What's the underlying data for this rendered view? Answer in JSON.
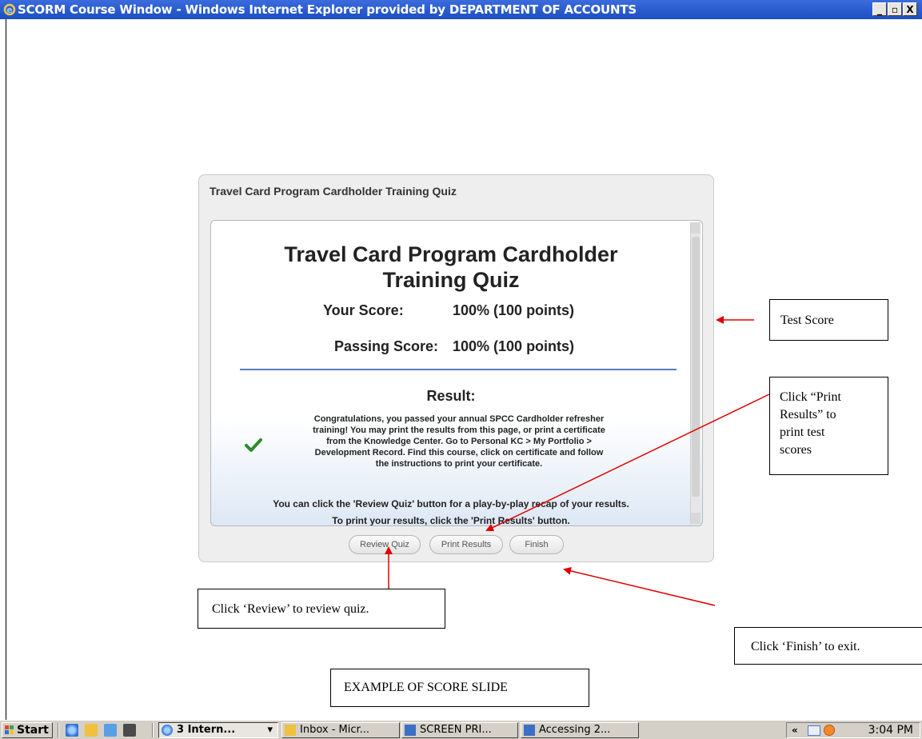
{
  "window": {
    "title": "SCORM Course Window - Windows Internet Explorer provided by DEPARTMENT OF ACCOUNTS",
    "minimize": "_",
    "maximize": "▫",
    "close": "X"
  },
  "course": {
    "panel_title": "Travel Card Program Cardholder Training Quiz",
    "quiz_title_line1": "Travel Card Program Cardholder",
    "quiz_title_line2": "Training Quiz",
    "your_score_label": "Your Score:",
    "your_score_value": "100% (100 points)",
    "passing_score_label": "Passing Score:",
    "passing_score_value": "100% (100 points)",
    "result_label": "Result:",
    "result_lines": [
      "Congratulations, you passed your annual SPCC Cardholder refresher",
      "training!  You may print the results from this page, or print a certificate",
      "from the Knowledge Center.  Go to Personal KC > My Portfolio >",
      "Development Record.  Find this course, click on certificate and follow",
      "the instructions to print your certificate."
    ],
    "review_text": "You can click the 'Review Quiz' button for a play-by-play recap of your results.",
    "print_text": "To print your results, click the 'Print Results' button.",
    "buttons": {
      "review": "Review Quiz",
      "print": "Print Results",
      "finish": "Finish"
    }
  },
  "annotations": {
    "test_score": "Test Score",
    "print_results": [
      "Click “Print",
      "Results” to",
      "print test",
      "scores"
    ],
    "review": "Click ‘Review’ to review quiz.",
    "finish": "Click ‘Finish’ to exit.",
    "example": "EXAMPLE OF SCORE SLIDE"
  },
  "taskbar": {
    "start": "Start",
    "tasks": [
      "3 Intern...",
      "Inbox - Micr...",
      "SCREEN PRI...",
      "Accessing 2..."
    ],
    "clock": "3:04 PM",
    "tray_chevron": "«"
  },
  "colors": {
    "titlebar": "#1c4fc1",
    "divider": "#5a7cc0",
    "arrow": "#e00000",
    "check": "#2e8b2e"
  }
}
